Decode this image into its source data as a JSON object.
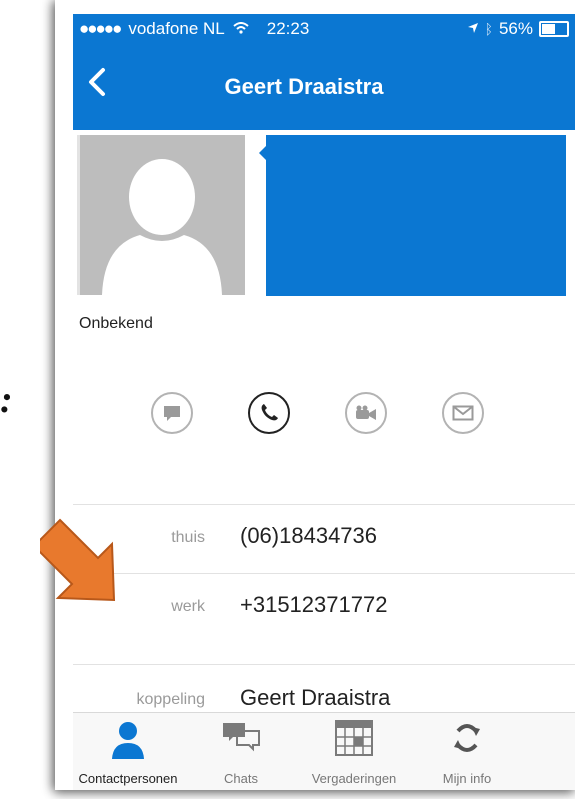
{
  "status": {
    "carrier": "vodafone NL",
    "time": "22:23",
    "battery": "56%"
  },
  "nav": {
    "title": "Geert Draaistra"
  },
  "contact": {
    "avatar_caption": "Onbekend"
  },
  "fields": [
    {
      "label": "thuis",
      "value": "(06)18434736"
    },
    {
      "label": "werk",
      "value": "+31512371772"
    },
    {
      "label": "koppeling",
      "value": "Geert Draaistra"
    }
  ],
  "tabs": [
    {
      "label": "Contactpersonen",
      "icon": "person-icon",
      "active": true
    },
    {
      "label": "Chats",
      "icon": "chats-icon",
      "active": false
    },
    {
      "label": "Vergaderingen",
      "icon": "calendar-icon",
      "active": false
    },
    {
      "label": "Mijn info",
      "icon": "sync-icon",
      "active": false
    }
  ],
  "annotation": {
    "colon_text": ":",
    "arrow_color": "#e8792d"
  },
  "colors": {
    "accent": "#0b77d2",
    "tab_active": "#0b77d2",
    "tab_inactive": "#7a7a7a"
  }
}
